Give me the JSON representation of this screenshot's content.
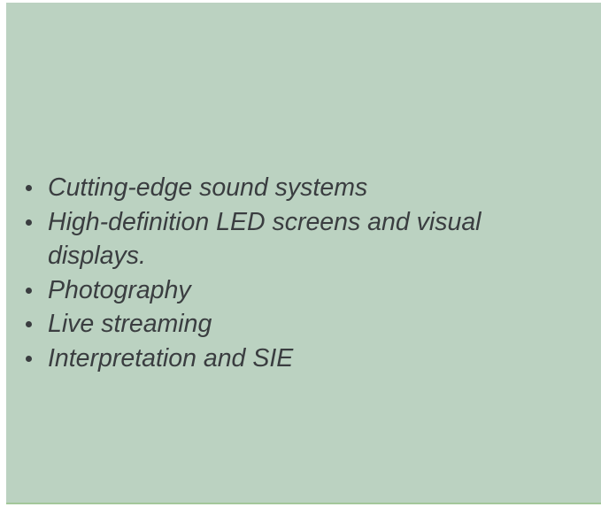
{
  "services": {
    "items": [
      {
        "label": "Cutting-edge sound systems"
      },
      {
        "label": "High-definition LED screens and visual displays."
      },
      {
        "label": "Photography"
      },
      {
        "label": "Live streaming"
      },
      {
        "label": "Interpretation and SIE"
      }
    ]
  },
  "colors": {
    "panel_background": "#bbd2c1",
    "text": "#3a3d40",
    "bottom_border": "#a3c79a"
  }
}
